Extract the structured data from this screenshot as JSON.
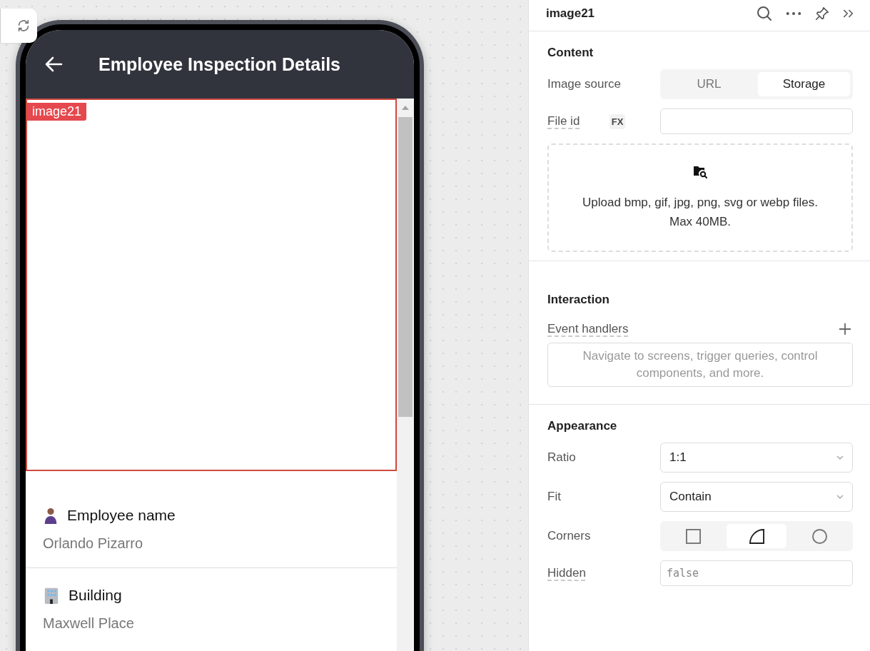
{
  "phone": {
    "title": "Employee Inspection Details",
    "selected_component": {
      "label": "image21"
    },
    "fields": [
      {
        "kind": "person",
        "label": "Employee name",
        "value": "Orlando Pizarro"
      },
      {
        "kind": "building",
        "label": "Building",
        "value": "Maxwell Place"
      }
    ]
  },
  "inspector": {
    "title": "image21",
    "content": {
      "title": "Content",
      "image_source": {
        "label": "Image source",
        "options": [
          {
            "label": "URL",
            "selected": false
          },
          {
            "label": "Storage",
            "selected": true
          }
        ]
      },
      "file_id": {
        "label": "File id",
        "fx": "FX"
      },
      "upload": {
        "text": "Upload bmp, gif, jpg, png, svg or webp files.\nMax 40MB."
      }
    },
    "interaction": {
      "title": "Interaction",
      "event_handlers": {
        "label": "Event handlers",
        "empty_text": "Navigate to screens, trigger queries, control components, and more."
      }
    },
    "appearance": {
      "title": "Appearance",
      "ratio": {
        "label": "Ratio",
        "value": "1:1"
      },
      "fit": {
        "label": "Fit",
        "value": "Contain"
      },
      "corners": {
        "label": "Corners",
        "options": [
          {
            "kind": "square",
            "selected": false
          },
          {
            "kind": "rounded",
            "selected": true
          },
          {
            "kind": "circle",
            "selected": false
          }
        ]
      },
      "hidden": {
        "label": "Hidden",
        "placeholder": "false"
      }
    }
  }
}
